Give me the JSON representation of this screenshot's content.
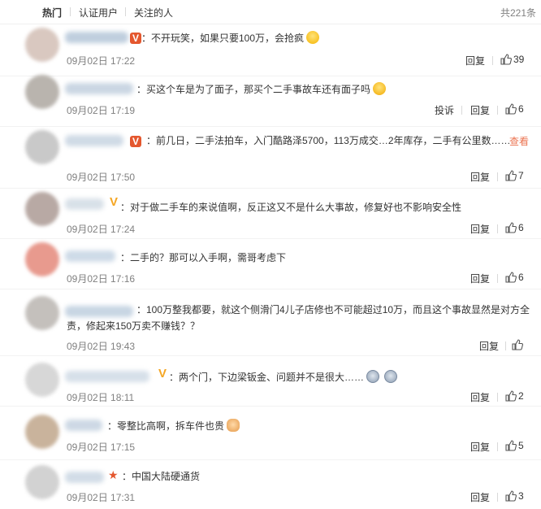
{
  "tabs": {
    "hot": "热门",
    "verified": "认证用户",
    "following": "关注的人",
    "total": "共221条"
  },
  "actions": {
    "reply": "回复",
    "report": "投诉",
    "more": "查看"
  },
  "colors": {
    "accent": "#eb7350",
    "badge_red": "#e4572e",
    "badge_gold": "#f5a623",
    "muted": "#808080"
  },
  "comments": [
    {
      "text": "：不开玩笑，如果只要100万，会抢疯",
      "emoji": "laugh-icon",
      "time": "09月02日 17:22",
      "likes": "39",
      "badge": "red-v"
    },
    {
      "text": "：买这个车是为了面子，那买个二手事故车还有面子吗",
      "emoji": "sweat-icon",
      "time": "09月02日 17:19",
      "likes": "6",
      "report": true
    },
    {
      "text": "：前几日，二手法拍车，入门酷路泽5700，113万成交…2年库存，二手有公里数……",
      "time": "09月02日 17:50",
      "likes": "7",
      "badge": "red-v",
      "more": true
    },
    {
      "text": "：对于做二手车的来说值啊，反正这又不是什么大事故，修复好也不影响安全性",
      "time": "09月02日 17:24",
      "likes": "6",
      "badge": "gold-v"
    },
    {
      "text": "：二手的？那可以入手啊，需哥考虑下",
      "time": "09月02日 17:16",
      "likes": "6"
    },
    {
      "text": "：100万整我都要，就这个侧滑门4儿子店修也不可能超过10万，而且这个事故显然是对方全责，修起来150万卖不赚钱？？",
      "time": "09月02日 19:43",
      "likes": "赞"
    },
    {
      "text": "：两个门，下边梁钣金、问题并不是很大……",
      "emoji": "dog-icon",
      "time": "09月02日 18:11",
      "likes": "2",
      "badge": "gold-v"
    },
    {
      "text": "：零整比高啊，拆车件也贵",
      "emoji": "cat-icon",
      "time": "09月02日 17:15",
      "likes": "5"
    },
    {
      "text": "：中国大陆硬通货",
      "time": "09月02日 17:31",
      "likes": "3",
      "badge": "red-star"
    }
  ]
}
